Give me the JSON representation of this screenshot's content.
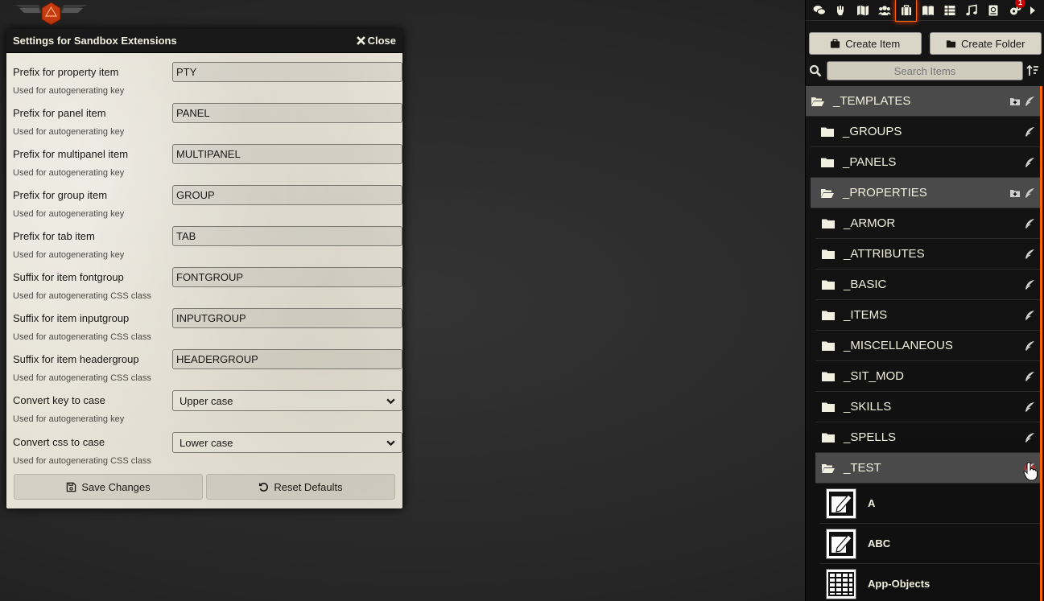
{
  "dialog": {
    "title": "Settings for Sandbox Extensions",
    "close_label": "Close",
    "fields": [
      {
        "label": "Prefix for property item",
        "hint": "Used for autogenerating key",
        "value": "PTY"
      },
      {
        "label": "Prefix for panel item",
        "hint": "Used for autogenerating key",
        "value": "PANEL"
      },
      {
        "label": "Prefix for multipanel item",
        "hint": "Used for autogenerating key",
        "value": "MULTIPANEL"
      },
      {
        "label": "Prefix for group item",
        "hint": "Used for autogenerating key",
        "value": "GROUP"
      },
      {
        "label": "Prefix for tab item",
        "hint": "Used for autogenerating key",
        "value": "TAB"
      },
      {
        "label": "Suffix for item fontgroup",
        "hint": "Used for autogenerating CSS class",
        "value": "FONTGROUP"
      },
      {
        "label": "Suffix for item inputgroup",
        "hint": "Used for autogenerating CSS class",
        "value": "INPUTGROUP"
      },
      {
        "label": "Suffix for item headergroup",
        "hint": "Used for autogenerating CSS class",
        "value": "HEADERGROUP"
      }
    ],
    "selects": [
      {
        "label": "Convert key to case",
        "hint": "Used for autogenerating key",
        "value": "Upper case"
      },
      {
        "label": "Convert css to case",
        "hint": "Used for autogenerating CSS class",
        "value": "Lower case"
      }
    ],
    "save_label": "Save Changes",
    "reset_label": "Reset Defaults"
  },
  "sidebar": {
    "tabs": [
      {
        "icon": "chat-icon"
      },
      {
        "icon": "combat-icon"
      },
      {
        "icon": "map-icon"
      },
      {
        "icon": "actors-icon"
      },
      {
        "icon": "items-icon",
        "active": true
      },
      {
        "icon": "journal-icon"
      },
      {
        "icon": "tables-icon"
      },
      {
        "icon": "playlists-icon"
      },
      {
        "icon": "compendium-icon"
      },
      {
        "icon": "settings-icon",
        "badge": "1"
      },
      {
        "icon": "collapse-icon"
      }
    ],
    "create_item_label": "Create Item",
    "create_folder_label": "Create Folder",
    "search_placeholder": "Search Items",
    "tree": {
      "root": "_TEMPLATES",
      "level1": [
        "_GROUPS",
        "_PANELS"
      ],
      "properties": "_PROPERTIES",
      "level2": [
        "_ARMOR",
        "_ATTRIBUTES",
        "_BASIC",
        "_ITEMS",
        "_MISCELLANEOUS",
        "_SIT_MOD",
        "_SKILLS",
        "_SPELLS"
      ],
      "test": "_TEST",
      "items": [
        "A",
        "ABC",
        "App-Objects"
      ]
    }
  },
  "colors": {
    "accent": "#ff6400",
    "parchment": "#e6e2d6",
    "header_dark": "#191919",
    "sidebar_bg": "#111111"
  }
}
